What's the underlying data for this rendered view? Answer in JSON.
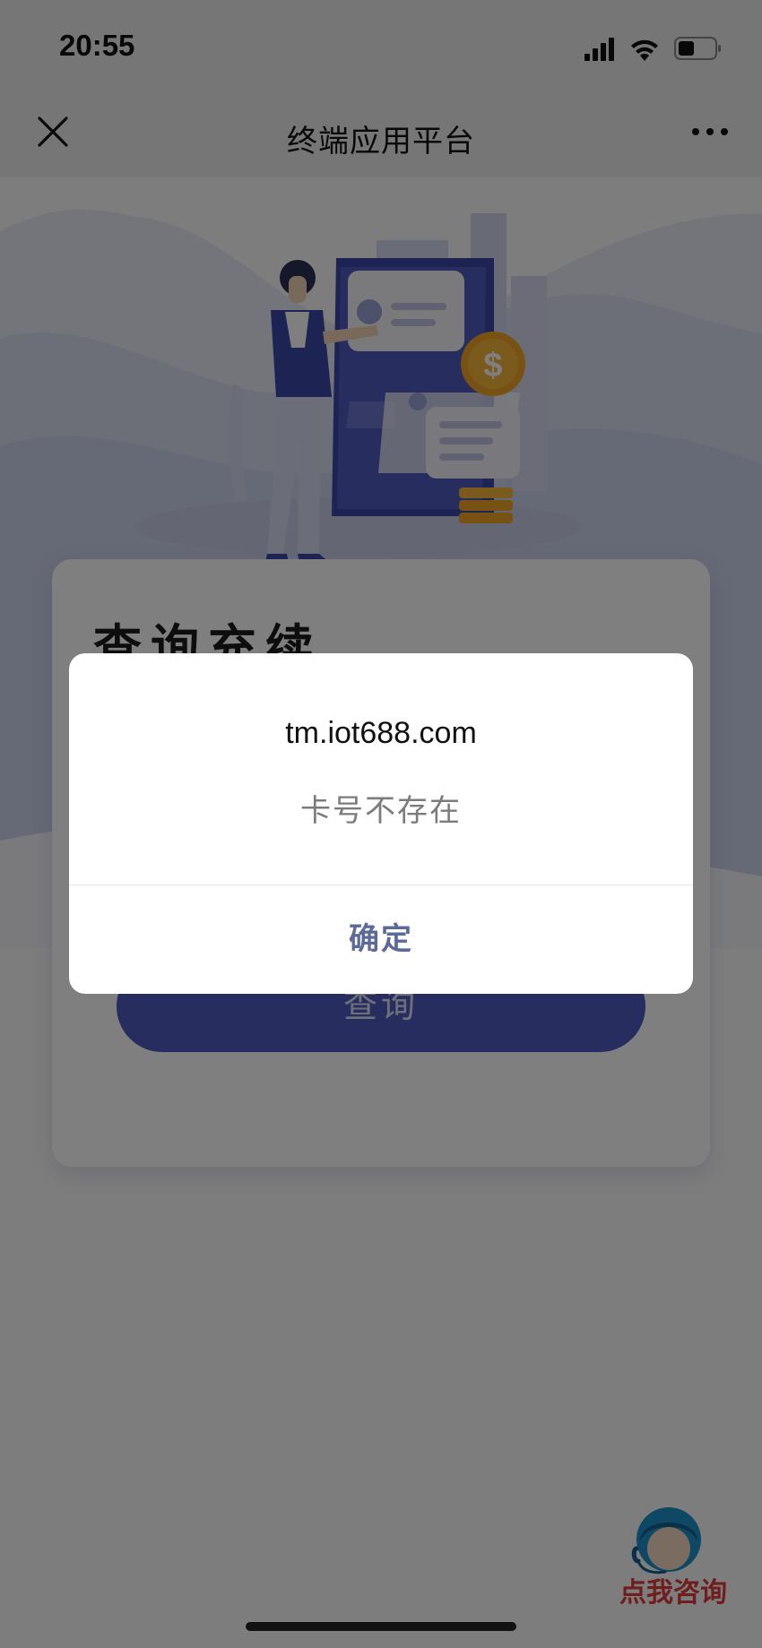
{
  "status_bar": {
    "time": "20:55"
  },
  "nav": {
    "title": "终端应用平台",
    "close_icon": "close-icon",
    "more_icon": "more-icon"
  },
  "card": {
    "title": "查询充续",
    "query_button_label": "查询"
  },
  "consult": {
    "label": "点我咨询",
    "icon": "customer-service-icon"
  },
  "dialog": {
    "title": "tm.iot688.com",
    "message": "卡号不存在",
    "confirm_label": "确定"
  },
  "colors": {
    "accent": "#4f5bbd",
    "dialog_button": "#5b6a99",
    "consult_label": "#e13b3b"
  }
}
